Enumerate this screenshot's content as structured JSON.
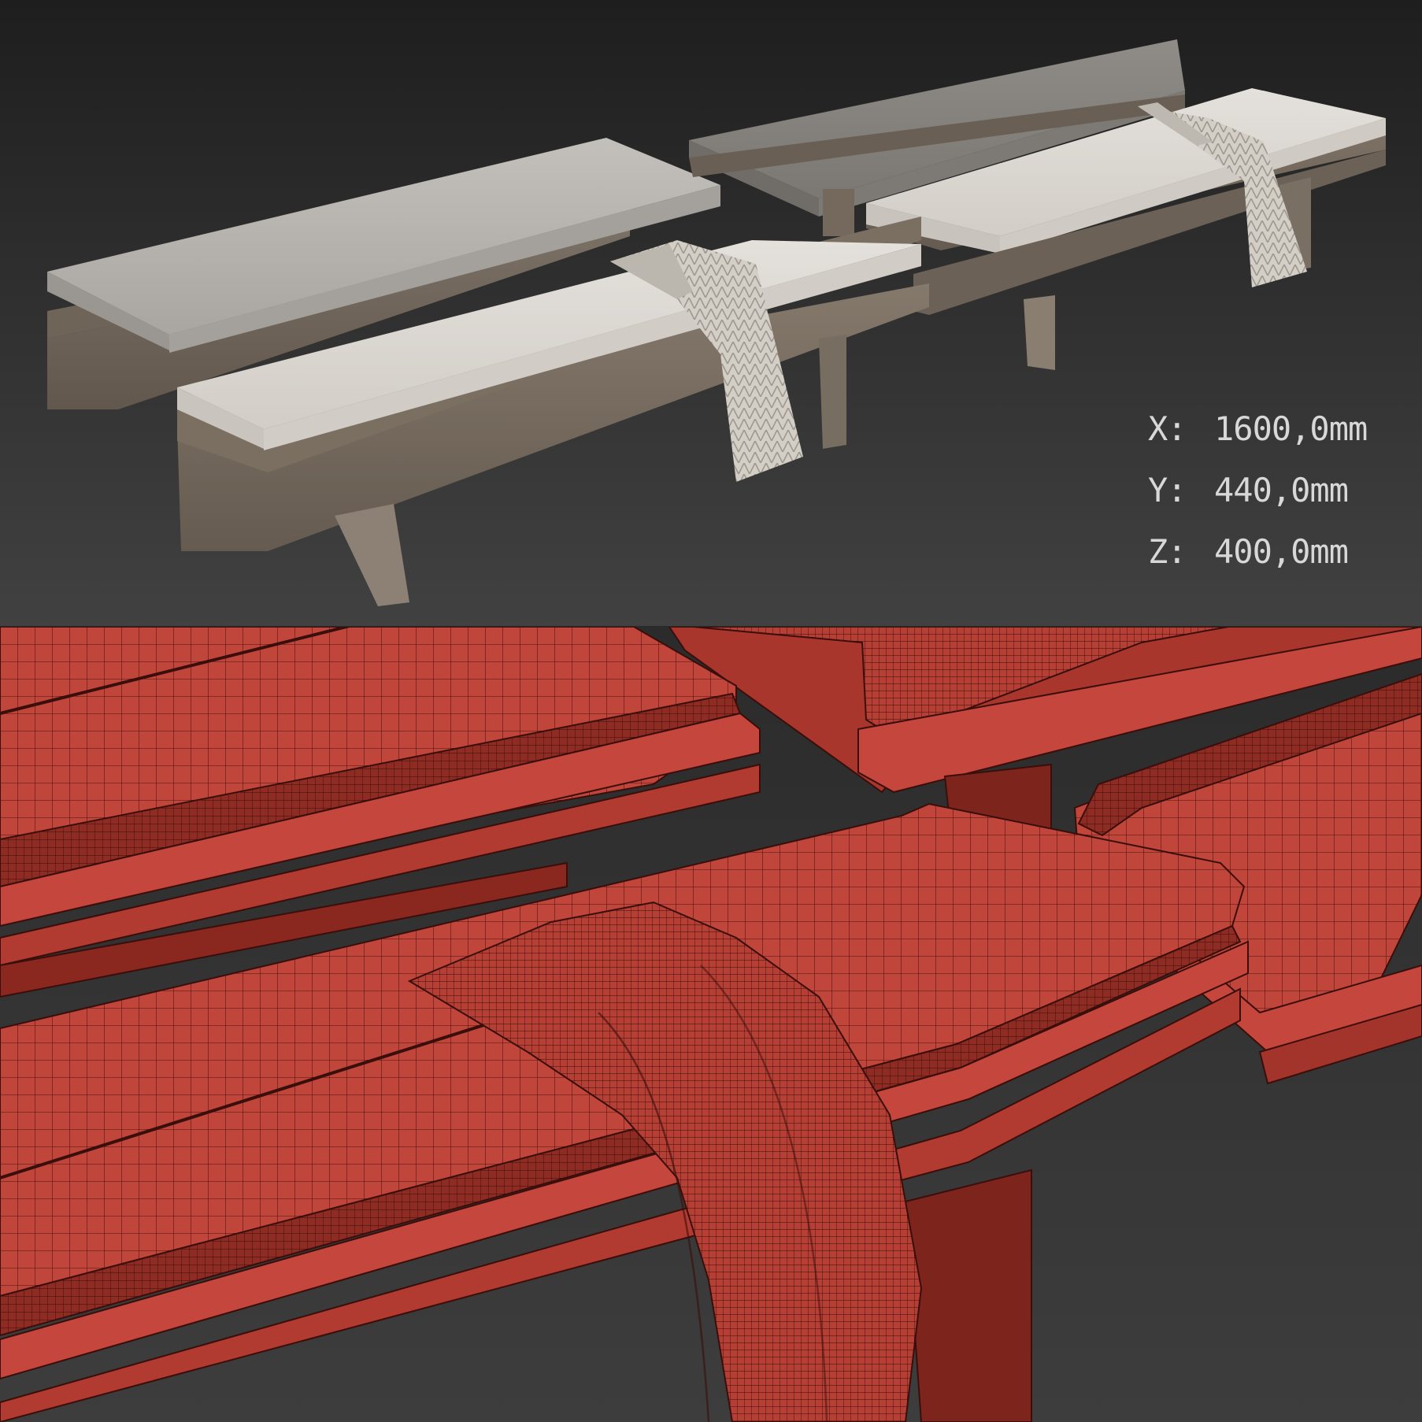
{
  "dimensions": [
    {
      "axis": "X:",
      "value": "1600,0mm"
    },
    {
      "axis": "Y:",
      "value": "440,0mm"
    },
    {
      "axis": "Z:",
      "value": "400,0mm"
    }
  ],
  "colors": {
    "cushion_grey": "#b9b6b1",
    "cushion_dark": "#8e8b86",
    "cushion_light": "#dcd7d2",
    "wood": "#7a6e62",
    "throw": "#cfcac2",
    "wire_fill": "#c0453b",
    "wire_line": "#3a0e0a"
  }
}
